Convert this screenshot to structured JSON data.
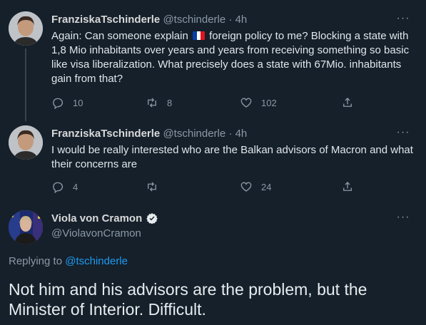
{
  "tweets": [
    {
      "name": "FranziskaTschinderle",
      "handle": "@tschinderle",
      "time": "· 4h",
      "text_before_flag": "Again: Can someone explain ",
      "text_after_flag": " foreign policy to me? Blocking a state with 1,8 Mio inhabitants over years and years from receiving something so basic like visa liberalization. What precisely does a state with 67Mio. inhabitants gain from that?",
      "flag_colors": [
        "#0a3fa3",
        "#ffffff",
        "#e1131e"
      ],
      "reply_count": "10",
      "retweet_count": "8",
      "like_count": "102"
    },
    {
      "name": "FranziskaTschinderle",
      "handle": "@tschinderle",
      "time": "· 4h",
      "text": "I would be really interested who are the Balkan advisors of Macron and what their concerns are",
      "reply_count": "4",
      "retweet_count": "",
      "like_count": "24"
    }
  ],
  "main_tweet": {
    "name": "Viola von Cramon",
    "handle": "@ViolavonCramon",
    "replying_prefix": "Replying to",
    "replying_to": "@tschinderle",
    "text": "Not him and his advisors are the problem, but the Minister of Interior. Difficult."
  },
  "colors": {
    "background": "#15202b",
    "accent": "#1d9bf0",
    "muted": "#8b98a5"
  },
  "icons": [
    "reply-icon",
    "retweet-icon",
    "like-icon",
    "share-icon",
    "more-icon",
    "verified-badge-icon"
  ]
}
